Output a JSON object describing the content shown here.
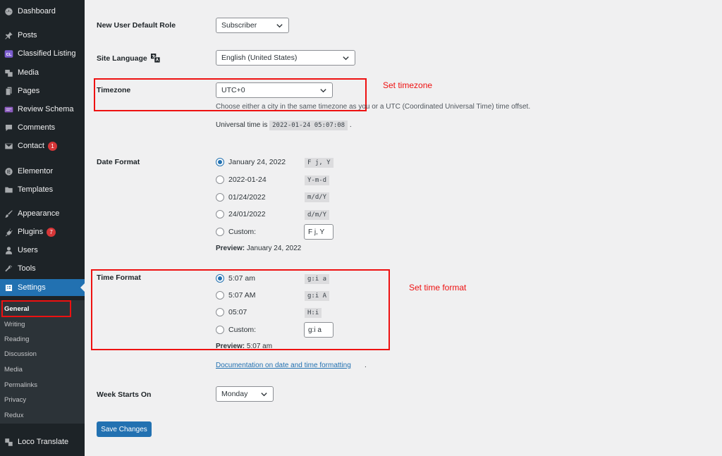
{
  "sidebar": {
    "items": [
      {
        "label": "Dashboard",
        "icon": "dashboard-icon"
      },
      {
        "label": "Posts",
        "icon": "pin-icon"
      },
      {
        "label": "Classified Listing",
        "icon": "cl-icon"
      },
      {
        "label": "Media",
        "icon": "media-icon"
      },
      {
        "label": "Pages",
        "icon": "pages-icon"
      },
      {
        "label": "Review Schema",
        "icon": "review-icon"
      },
      {
        "label": "Comments",
        "icon": "comments-icon"
      },
      {
        "label": "Contact",
        "icon": "mail-icon",
        "badge": "1"
      },
      {
        "label": "Elementor",
        "icon": "elementor-icon"
      },
      {
        "label": "Templates",
        "icon": "folder-icon"
      },
      {
        "label": "Appearance",
        "icon": "brush-icon"
      },
      {
        "label": "Plugins",
        "icon": "plug-icon",
        "badge": "7"
      },
      {
        "label": "Users",
        "icon": "user-icon"
      },
      {
        "label": "Tools",
        "icon": "wrench-icon"
      },
      {
        "label": "Settings",
        "icon": "settings-icon"
      },
      {
        "label": "Loco Translate",
        "icon": "translate-icon"
      }
    ],
    "submenu": [
      "General",
      "Writing",
      "Reading",
      "Discussion",
      "Media",
      "Permalinks",
      "Privacy",
      "Redux"
    ]
  },
  "settings": {
    "default_role": {
      "label": "New User Default Role",
      "value": "Subscriber"
    },
    "site_language": {
      "label": "Site Language",
      "value": "English (United States)"
    },
    "timezone": {
      "label": "Timezone",
      "value": "UTC+0",
      "description": "Choose either a city in the same timezone as you or a UTC (Coordinated Universal Time) time offset.",
      "universal_prefix": "Universal time is",
      "universal_time": "2022-01-24 05:07:08",
      "universal_suffix": "."
    },
    "date_format": {
      "label": "Date Format",
      "options": [
        {
          "label": "January 24, 2022",
          "code": "F j, Y",
          "checked": true
        },
        {
          "label": "2022-01-24",
          "code": "Y-m-d"
        },
        {
          "label": "01/24/2022",
          "code": "m/d/Y"
        },
        {
          "label": "24/01/2022",
          "code": "d/m/Y"
        }
      ],
      "custom_label": "Custom:",
      "custom_value": "F j, Y",
      "preview_label": "Preview:",
      "preview_value": "January 24, 2022"
    },
    "time_format": {
      "label": "Time Format",
      "options": [
        {
          "label": "5:07 am",
          "code": "g:i a",
          "checked": true
        },
        {
          "label": "5:07 AM",
          "code": "g:i A"
        },
        {
          "label": "05:07",
          "code": "H:i"
        }
      ],
      "custom_label": "Custom:",
      "custom_value": "g:i a",
      "preview_label": "Preview:",
      "preview_value": "5:07 am"
    },
    "doc_link": "Documentation on date and time formatting",
    "doc_link_suffix": ".",
    "week_starts": {
      "label": "Week Starts On",
      "value": "Monday"
    },
    "save_button": "Save Changes"
  },
  "annotations": {
    "timezone_note": "Set timezone",
    "time_format_note": "Set time format"
  },
  "colors": {
    "accent": "#2271b1",
    "sidebar_bg": "#1d2327",
    "annotation_red": "#e11",
    "badge_red": "#d63638"
  }
}
